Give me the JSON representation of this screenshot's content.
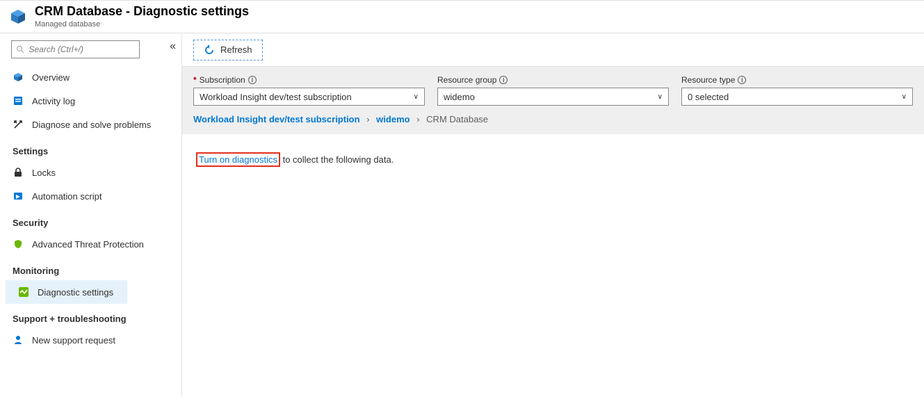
{
  "header": {
    "title": "CRM Database - Diagnostic settings",
    "subtitle": "Managed database"
  },
  "sidebar": {
    "search_placeholder": "Search (Ctrl+/)",
    "items_top": [
      {
        "label": "Overview"
      },
      {
        "label": "Activity log"
      },
      {
        "label": "Diagnose and solve problems"
      }
    ],
    "sections": {
      "settings": {
        "heading": "Settings",
        "items": [
          {
            "label": "Locks"
          },
          {
            "label": "Automation script"
          }
        ]
      },
      "security": {
        "heading": "Security",
        "items": [
          {
            "label": "Advanced Threat Protection"
          }
        ]
      },
      "monitoring": {
        "heading": "Monitoring",
        "items": [
          {
            "label": "Diagnostic settings"
          }
        ]
      },
      "support": {
        "heading": "Support + troubleshooting",
        "items": [
          {
            "label": "New support request"
          }
        ]
      }
    }
  },
  "toolbar": {
    "refresh_label": "Refresh"
  },
  "filters": {
    "subscription": {
      "label": "Subscription",
      "value": "Workload Insight dev/test subscription"
    },
    "resource_group": {
      "label": "Resource group",
      "value": "widemo"
    },
    "resource_type": {
      "label": "Resource type",
      "value": "0 selected"
    }
  },
  "breadcrumb": {
    "a": "Workload Insight dev/test subscription",
    "b": "widemo",
    "c": "CRM Database"
  },
  "content": {
    "link_text": "Turn on diagnostics",
    "rest_text": " to collect the following data."
  }
}
